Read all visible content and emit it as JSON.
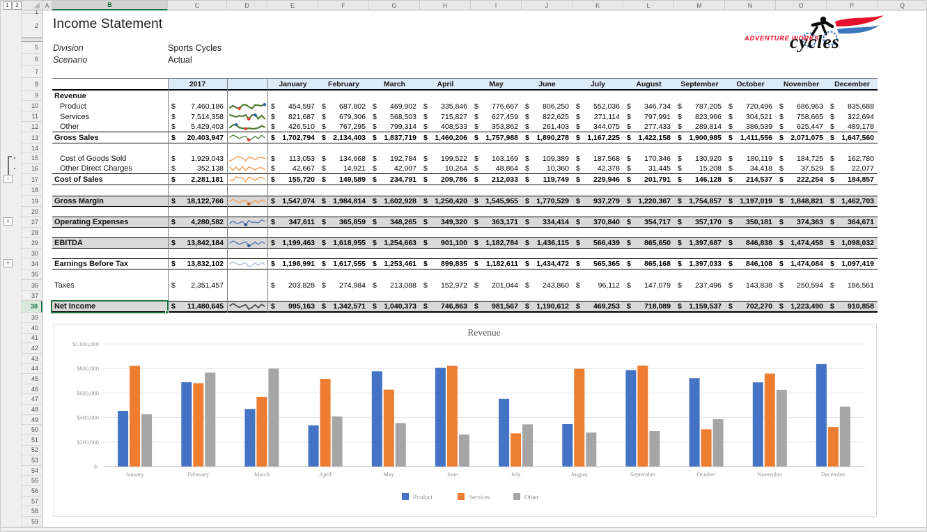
{
  "app": {
    "columns": [
      "A",
      "B",
      "C",
      "D",
      "E",
      "F",
      "G",
      "H",
      "I",
      "J",
      "K",
      "L",
      "M",
      "N",
      "O",
      "P",
      "Q"
    ],
    "selected_column": "B",
    "selected_row": 38,
    "row_headers": [
      1,
      2,
      5,
      6,
      7,
      8,
      9,
      10,
      11,
      12,
      13,
      14,
      15,
      16,
      17,
      18,
      19,
      20,
      27,
      28,
      29,
      30,
      34,
      35,
      36,
      37,
      38,
      39,
      40,
      41,
      42,
      43,
      44,
      45,
      46,
      47,
      48,
      49,
      50,
      51,
      52,
      53,
      54,
      55,
      56,
      57,
      58,
      59
    ],
    "outline": {
      "levels": [
        "1",
        "2"
      ],
      "collapse_label": "-",
      "expand_label": "+"
    }
  },
  "header": {
    "title": "Income Statement",
    "division_label": "Division",
    "division_value": "Sports Cycles",
    "scenario_label": "Scenario",
    "scenario_value": "Actual"
  },
  "logo": {
    "line1": "ADVENTURE WORKS",
    "line2": "cycles"
  },
  "table": {
    "year_header": "2017",
    "months": [
      "January",
      "February",
      "March",
      "April",
      "May",
      "June",
      "July",
      "August",
      "September",
      "October",
      "November",
      "December"
    ],
    "currency": "$",
    "rows": [
      {
        "r": 9,
        "label": "Revenue",
        "kind": "section"
      },
      {
        "r": 10,
        "label": "Product",
        "kind": "item",
        "spark": "revenue",
        "total": 7460186,
        "months": [
          454597,
          687802,
          469902,
          335846,
          776667,
          806250,
          552036,
          346734,
          787205,
          720496,
          686963,
          835688
        ]
      },
      {
        "r": 11,
        "label": "Services",
        "kind": "item",
        "spark": "revenue",
        "total": 7514358,
        "months": [
          821687,
          679306,
          568503,
          715827,
          627459,
          822625,
          271114,
          797991,
          823966,
          304521,
          758665,
          322694
        ]
      },
      {
        "r": 12,
        "label": "Other",
        "kind": "item",
        "spark": "revenue",
        "bb": true,
        "total": 5429403,
        "months": [
          426510,
          767295,
          799314,
          408533,
          353862,
          261403,
          344075,
          277433,
          289814,
          386539,
          625447,
          489178
        ]
      },
      {
        "r": 13,
        "label": "Gross Sales",
        "kind": "subtotal",
        "spark": "gross",
        "bb": true,
        "total": 20403947,
        "months": [
          1702794,
          2134403,
          1837719,
          1460206,
          1757988,
          1890278,
          1167225,
          1422158,
          1900985,
          1411556,
          2071075,
          1647560
        ]
      },
      {
        "r": 15,
        "label": "Cost of Goods Sold",
        "kind": "item",
        "spark": "cost",
        "total": 1929043,
        "months": [
          113053,
          134668,
          192784,
          199522,
          163169,
          109389,
          187568,
          170346,
          130920,
          180119,
          184725,
          162780
        ]
      },
      {
        "r": 16,
        "label": "Other Direct Charges",
        "kind": "item",
        "spark": "cost",
        "bb": true,
        "total": 352138,
        "months": [
          42667,
          14921,
          42007,
          10264,
          48864,
          10360,
          42378,
          31445,
          15208,
          34418,
          37529,
          22077
        ]
      },
      {
        "r": 17,
        "label": "Cost of Sales",
        "kind": "subtotal",
        "spark": "cost",
        "bb": true,
        "total": 2281181,
        "months": [
          155720,
          149589,
          234791,
          209786,
          212033,
          119749,
          229946,
          201791,
          146128,
          214537,
          222254,
          184857
        ]
      },
      {
        "r": 19,
        "label": "Gross Margin",
        "kind": "band",
        "spark": "margin",
        "bt": true,
        "bb": true,
        "total": 18122766,
        "months": [
          1547074,
          1984814,
          1602928,
          1250420,
          1545955,
          1770529,
          937279,
          1220367,
          1754857,
          1197019,
          1848821,
          1462703
        ]
      },
      {
        "r": 27,
        "label": "Operating Expenses",
        "kind": "band",
        "spark": "opex",
        "bt": true,
        "bb": true,
        "total": 4280582,
        "months": [
          347611,
          365859,
          348265,
          349320,
          363171,
          334414,
          370840,
          354717,
          357170,
          350181,
          374363,
          364671
        ]
      },
      {
        "r": 29,
        "label": "EBITDA",
        "kind": "band",
        "spark": "opex",
        "bt": true,
        "bb": true,
        "total": 13842184,
        "months": [
          1199463,
          1618955,
          1254663,
          901100,
          1182784,
          1436115,
          566439,
          865650,
          1397687,
          846838,
          1474458,
          1098032
        ]
      },
      {
        "r": 34,
        "label": "Earnings Before Tax",
        "kind": "subtotal",
        "spark": "ebt",
        "bt": true,
        "bb": true,
        "total": 13832102,
        "months": [
          1198991,
          1617555,
          1253461,
          899835,
          1182611,
          1434472,
          565365,
          865168,
          1397033,
          846108,
          1474084,
          1097419
        ]
      },
      {
        "r": 36,
        "label": "Taxes",
        "kind": "plain",
        "total": 2351457,
        "months": [
          203828,
          274984,
          213088,
          152972,
          201044,
          243860,
          96112,
          147079,
          237496,
          143838,
          250594,
          186561
        ]
      },
      {
        "r": 38,
        "label": "Net Income",
        "kind": "band",
        "spark": "net",
        "bt": true,
        "thick": true,
        "selected": true,
        "total": 11480645,
        "months": [
          995163,
          1342571,
          1040373,
          746863,
          981567,
          1190612,
          469253,
          718089,
          1159537,
          702270,
          1223490,
          910858
        ]
      }
    ]
  },
  "chart_data": {
    "type": "bar",
    "title": "Revenue",
    "categories": [
      "January",
      "February",
      "March",
      "April",
      "May",
      "June",
      "July",
      "August",
      "September",
      "October",
      "November",
      "December"
    ],
    "series": [
      {
        "name": "Product",
        "color": "#4472C4",
        "values": [
          454597,
          687802,
          469902,
          335846,
          776667,
          806250,
          552036,
          346734,
          787205,
          720496,
          686963,
          835688
        ]
      },
      {
        "name": "Services",
        "color": "#ED7D31",
        "values": [
          821687,
          679306,
          568503,
          715827,
          627459,
          822625,
          271114,
          797991,
          823966,
          304521,
          758665,
          322694
        ]
      },
      {
        "name": "Other",
        "color": "#A5A5A5",
        "values": [
          426510,
          767295,
          799314,
          408533,
          353862,
          261403,
          344075,
          277433,
          289814,
          386539,
          625447,
          489178
        ]
      }
    ],
    "ylim": [
      0,
      1000000
    ],
    "ytick_step": 200000,
    "ytick_labels": [
      "$-",
      "$200,000",
      "$400,000",
      "$600,000",
      "$800,000",
      "$1,000,000"
    ],
    "grid": true,
    "legend_position": "bottom"
  }
}
